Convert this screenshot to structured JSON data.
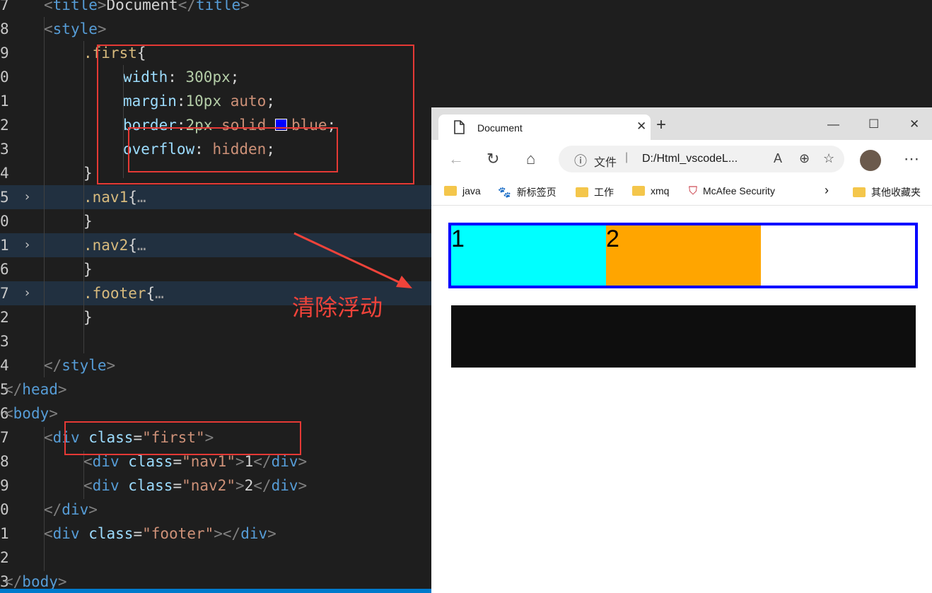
{
  "editor": {
    "lines": [
      {
        "ln": "7",
        "tokens": [
          {
            "c": "tag-bracket",
            "t": "<"
          },
          {
            "c": "tag",
            "t": "title"
          },
          {
            "c": "tag-bracket",
            "t": ">"
          },
          {
            "c": "txt",
            "t": "Document"
          },
          {
            "c": "tag-bracket",
            "t": "</"
          },
          {
            "c": "tag",
            "t": "title"
          },
          {
            "c": "tag-bracket",
            "t": ">"
          }
        ]
      },
      {
        "ln": "8",
        "tokens": [
          {
            "c": "tag-bracket",
            "t": "<"
          },
          {
            "c": "tag",
            "t": "style"
          },
          {
            "c": "tag-bracket",
            "t": ">"
          }
        ]
      },
      {
        "ln": "9",
        "tokens": [
          {
            "c": "sel",
            "t": ".first"
          },
          {
            "c": "punc",
            "t": "{"
          }
        ]
      },
      {
        "ln": "0",
        "tokens": [
          {
            "c": "prop",
            "t": "width"
          },
          {
            "c": "punc",
            "t": ": "
          },
          {
            "c": "num",
            "t": "300px"
          },
          {
            "c": "punc",
            "t": ";"
          }
        ]
      },
      {
        "ln": "1",
        "tokens": [
          {
            "c": "prop",
            "t": "margin"
          },
          {
            "c": "punc",
            "t": ":"
          },
          {
            "c": "num",
            "t": "10px"
          },
          {
            "c": "val",
            "t": " auto"
          },
          {
            "c": "punc",
            "t": ";"
          }
        ]
      },
      {
        "ln": "2",
        "tokens": [
          {
            "c": "prop",
            "t": "border"
          },
          {
            "c": "punc",
            "t": ":"
          },
          {
            "c": "num",
            "t": "2px"
          },
          {
            "c": "val",
            "t": " solid "
          },
          {
            "c": "swatch",
            "t": ""
          },
          {
            "c": "val",
            "t": "blue"
          },
          {
            "c": "punc",
            "t": ";"
          }
        ]
      },
      {
        "ln": "3",
        "tokens": [
          {
            "c": "prop",
            "t": "overflow"
          },
          {
            "c": "punc",
            "t": ": "
          },
          {
            "c": "val",
            "t": "hidden"
          },
          {
            "c": "punc",
            "t": ";"
          }
        ]
      },
      {
        "ln": "4",
        "tokens": [
          {
            "c": "punc",
            "t": "}"
          }
        ]
      },
      {
        "ln": "5",
        "tokens": [
          {
            "c": "sel",
            "t": ".nav1"
          },
          {
            "c": "punc",
            "t": "{"
          },
          {
            "c": "ell",
            "t": "…"
          }
        ]
      },
      {
        "ln": "0",
        "tokens": [
          {
            "c": "punc",
            "t": "}"
          }
        ]
      },
      {
        "ln": "1",
        "tokens": [
          {
            "c": "sel",
            "t": ".nav2"
          },
          {
            "c": "punc",
            "t": "{"
          },
          {
            "c": "ell",
            "t": "…"
          }
        ]
      },
      {
        "ln": "6",
        "tokens": [
          {
            "c": "punc",
            "t": "}"
          }
        ]
      },
      {
        "ln": "7",
        "tokens": [
          {
            "c": "sel",
            "t": ".footer"
          },
          {
            "c": "punc",
            "t": "{"
          },
          {
            "c": "ell",
            "t": "…"
          }
        ]
      },
      {
        "ln": "2",
        "tokens": [
          {
            "c": "punc",
            "t": "}"
          }
        ]
      },
      {
        "ln": "3",
        "tokens": []
      },
      {
        "ln": "4",
        "tokens": [
          {
            "c": "tag-bracket",
            "t": "</"
          },
          {
            "c": "tag",
            "t": "style"
          },
          {
            "c": "tag-bracket",
            "t": ">"
          }
        ]
      },
      {
        "ln": "5",
        "tokens": [
          {
            "c": "tag-bracket",
            "t": "</"
          },
          {
            "c": "tag",
            "t": "head"
          },
          {
            "c": "tag-bracket",
            "t": ">"
          }
        ]
      },
      {
        "ln": "6",
        "tokens": [
          {
            "c": "tag-bracket",
            "t": "<"
          },
          {
            "c": "tag",
            "t": "body"
          },
          {
            "c": "tag-bracket",
            "t": ">"
          }
        ]
      },
      {
        "ln": "7",
        "tokens": [
          {
            "c": "tag-bracket",
            "t": "<"
          },
          {
            "c": "tag",
            "t": "div"
          },
          {
            "c": "attr",
            "t": " class"
          },
          {
            "c": "punc",
            "t": "="
          },
          {
            "c": "str",
            "t": "\"first\""
          },
          {
            "c": "tag-bracket",
            "t": ">"
          }
        ]
      },
      {
        "ln": "8",
        "tokens": [
          {
            "c": "tag-bracket",
            "t": "<"
          },
          {
            "c": "tag",
            "t": "div"
          },
          {
            "c": "attr",
            "t": " class"
          },
          {
            "c": "punc",
            "t": "="
          },
          {
            "c": "str",
            "t": "\"nav1\""
          },
          {
            "c": "tag-bracket",
            "t": ">"
          },
          {
            "c": "txt",
            "t": "1"
          },
          {
            "c": "tag-bracket",
            "t": "</"
          },
          {
            "c": "tag",
            "t": "div"
          },
          {
            "c": "tag-bracket",
            "t": ">"
          }
        ]
      },
      {
        "ln": "9",
        "tokens": [
          {
            "c": "tag-bracket",
            "t": "<"
          },
          {
            "c": "tag",
            "t": "div"
          },
          {
            "c": "attr",
            "t": " class"
          },
          {
            "c": "punc",
            "t": "="
          },
          {
            "c": "str",
            "t": "\"nav2\""
          },
          {
            "c": "tag-bracket",
            "t": ">"
          },
          {
            "c": "txt",
            "t": "2"
          },
          {
            "c": "tag-bracket",
            "t": "</"
          },
          {
            "c": "tag",
            "t": "div"
          },
          {
            "c": "tag-bracket",
            "t": ">"
          }
        ]
      },
      {
        "ln": "0",
        "tokens": [
          {
            "c": "tag-bracket",
            "t": "</"
          },
          {
            "c": "tag",
            "t": "div"
          },
          {
            "c": "tag-bracket",
            "t": ">"
          }
        ]
      },
      {
        "ln": "1",
        "tokens": [
          {
            "c": "tag-bracket",
            "t": "<"
          },
          {
            "c": "tag",
            "t": "div"
          },
          {
            "c": "attr",
            "t": " class"
          },
          {
            "c": "punc",
            "t": "="
          },
          {
            "c": "str",
            "t": "\"footer\""
          },
          {
            "c": "tag-bracket",
            "t": "></"
          },
          {
            "c": "tag",
            "t": "div"
          },
          {
            "c": "tag-bracket",
            "t": ">"
          }
        ]
      },
      {
        "ln": "2",
        "tokens": []
      },
      {
        "ln": "3",
        "tokens": [
          {
            "c": "tag-bracket",
            "t": "</"
          },
          {
            "c": "tag",
            "t": "body"
          },
          {
            "c": "tag-bracket",
            "t": ">"
          }
        ]
      }
    ],
    "annotation": "清除浮动",
    "annotation_color": "#f0433a"
  },
  "browser": {
    "tab_title": "Document",
    "url_label": "文件",
    "url_sep": "|",
    "url": "D:/Html_vscodeL...",
    "favorites": [
      "java",
      "新标签页",
      "工作",
      "xmq",
      "McAfee Security",
      "其他收藏夹"
    ],
    "page": {
      "nav1_text": "1",
      "nav2_text": "2",
      "nav1_color": "#00ffff",
      "nav2_color": "#ffa500",
      "border_color": "#0000ff",
      "footer_color": "#0e0e0e"
    }
  }
}
